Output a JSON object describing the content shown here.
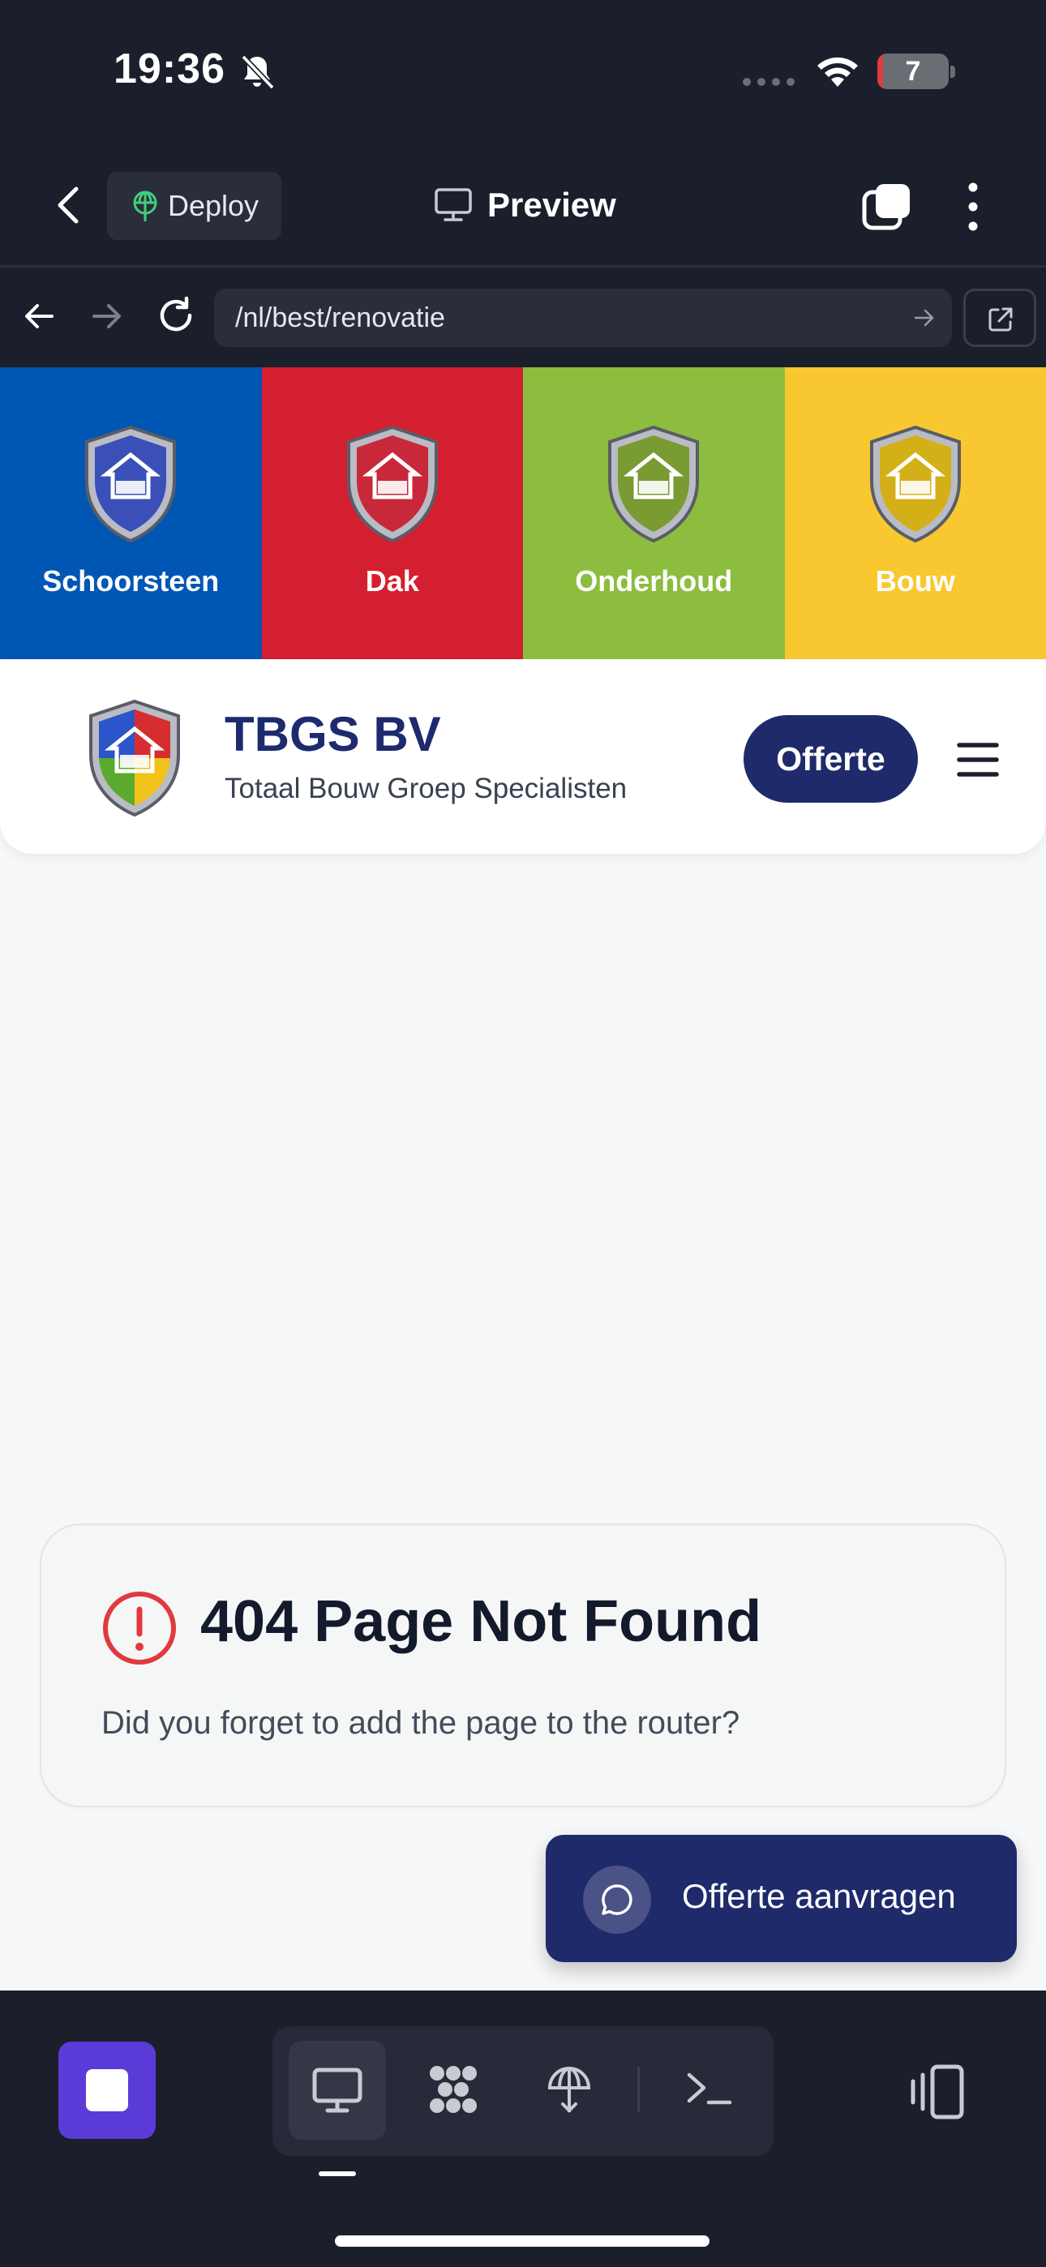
{
  "status_bar": {
    "time": "19:36",
    "battery_level": "7",
    "battery_fraction": 0.07,
    "icons": [
      "bell-slash-icon",
      "signal-icon",
      "wifi-icon",
      "battery-icon"
    ]
  },
  "app_header": {
    "deploy_label": "Deploy",
    "title": "Preview",
    "icons": [
      "back-icon",
      "deploy-icon",
      "monitor-icon",
      "tabs-icon",
      "more-icon"
    ]
  },
  "url_bar": {
    "path": "/nl/best/renovatie",
    "icons": [
      "arrow-left-icon",
      "arrow-right-icon",
      "reload-icon",
      "go-icon",
      "external-link-icon"
    ]
  },
  "site": {
    "categories": [
      {
        "label": "Schoorsteen",
        "color": "#0056b3",
        "shield": "#3a4fb8"
      },
      {
        "label": "Dak",
        "color": "#d41f30",
        "shield": "#c8283a"
      },
      {
        "label": "Onderhoud",
        "color": "#8cbd3f",
        "shield": "#7a9a32"
      },
      {
        "label": "Bouw",
        "color": "#f9c72f",
        "shield": "#d4b018"
      }
    ],
    "brand": {
      "name": "TBGS BV",
      "tagline": "Totaal Bouw Groep Specialisten",
      "color": "#1e2a6e"
    },
    "offerte_label": "Offerte",
    "error": {
      "title": "404 Page Not Found",
      "message": "Did you forget to add the page to the router?",
      "icon_color": "#e0393e"
    },
    "cta_label": "Offerte aanvragen"
  },
  "bottom_bar": {
    "stop_color": "#5b3bd8",
    "modes": [
      "monitor-icon",
      "apps-icon",
      "deploy-icon",
      "terminal-icon"
    ],
    "active_mode": "monitor-icon"
  }
}
